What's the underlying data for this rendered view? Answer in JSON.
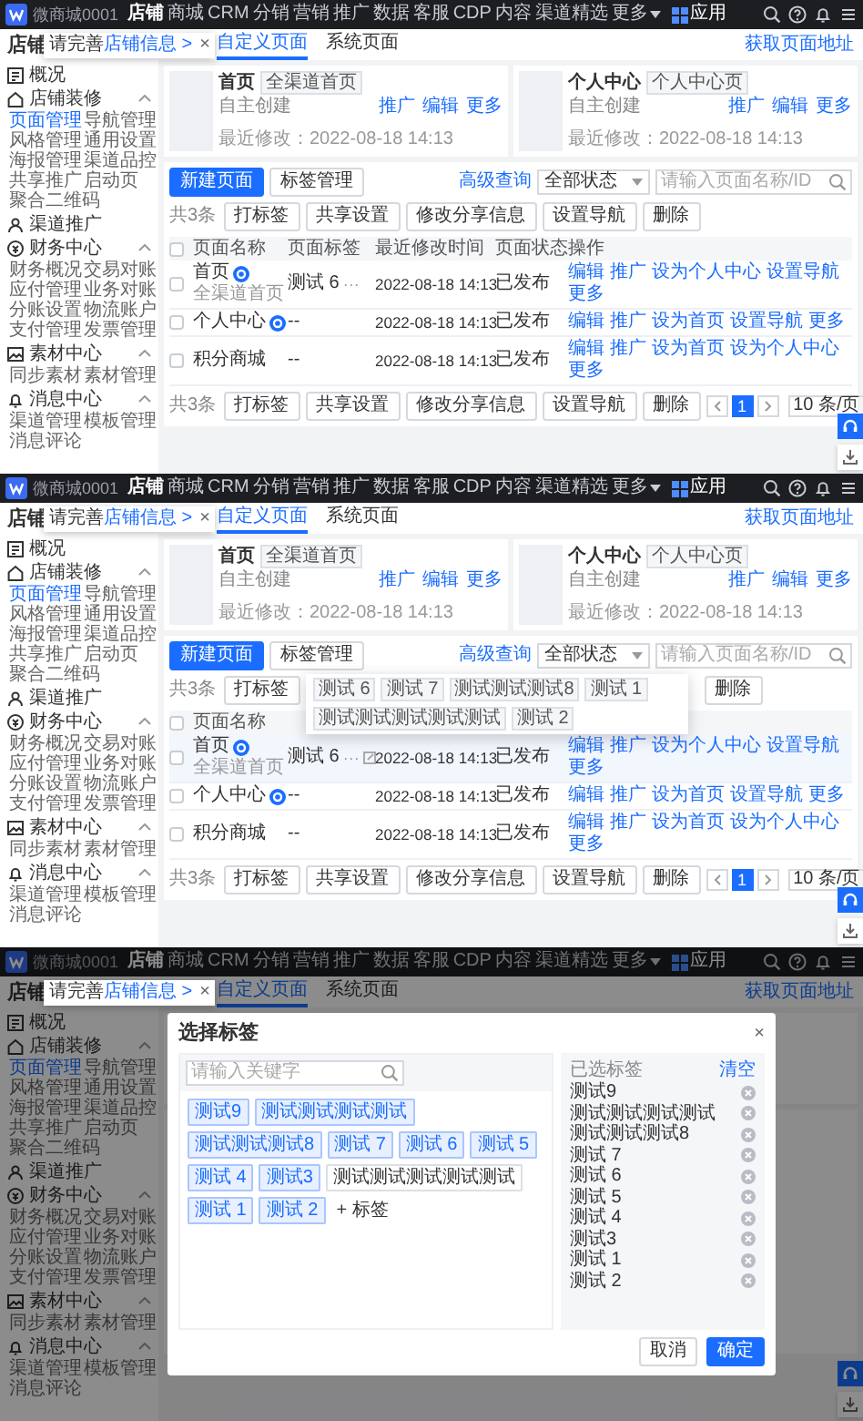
{
  "screens": [
    {
      "nav": {
        "brand": "微商城0001",
        "items": [
          {
            "label": "店铺",
            "kind": "link",
            "selected": true
          },
          {
            "label": "商城",
            "kind": "link",
            "selected": false
          },
          {
            "label": "CRM",
            "kind": "link",
            "selected": false
          },
          {
            "label": "分销",
            "kind": "link",
            "selected": false
          },
          {
            "label": "营销",
            "kind": "link",
            "selected": false
          },
          {
            "label": "推广",
            "kind": "link",
            "selected": false
          },
          {
            "label": "数据",
            "kind": "link",
            "selected": false
          },
          {
            "label": "客服",
            "kind": "link",
            "selected": false
          },
          {
            "label": "CDP",
            "kind": "link",
            "selected": false
          },
          {
            "label": "内容",
            "kind": "link",
            "selected": false
          },
          {
            "label": "渠道精选",
            "kind": "link",
            "selected": false
          },
          {
            "label": "更多",
            "kind": "dropdown",
            "selected": false
          },
          {
            "label": "应用",
            "kind": "apps",
            "selected": false
          }
        ]
      },
      "notice": {
        "text": "请完善",
        "link": "店铺信息 >",
        "close": "×"
      },
      "sidebar": {
        "title": "店铺",
        "groups": [
          {
            "label": "概况"
          },
          {
            "label": "店铺装修",
            "expanded": true,
            "items": [
              {
                "label": "页面管理",
                "selected": true
              },
              {
                "label": "导航管理",
                "selected": false
              },
              {
                "label": "风格管理",
                "selected": false
              },
              {
                "label": "通用设置",
                "selected": false
              },
              {
                "label": "海报管理",
                "selected": false
              },
              {
                "label": "渠道品控",
                "selected": false
              },
              {
                "label": "共享推广",
                "selected": false
              },
              {
                "label": "启动页",
                "selected": false
              },
              {
                "label": "聚合二维码",
                "selected": false
              }
            ]
          },
          {
            "label": "渠道推广"
          },
          {
            "label": "财务中心",
            "expanded": true,
            "items": [
              {
                "label": "财务概况",
                "selected": false
              },
              {
                "label": "交易对账",
                "selected": false
              },
              {
                "label": "应付管理",
                "selected": false
              },
              {
                "label": "业务对账",
                "selected": false
              },
              {
                "label": "分账设置",
                "selected": false
              },
              {
                "label": "物流账户",
                "selected": false
              },
              {
                "label": "支付管理",
                "selected": false
              },
              {
                "label": "发票管理",
                "selected": false
              }
            ]
          },
          {
            "label": "素材中心",
            "expanded": true,
            "items": [
              {
                "label": "同步素材",
                "selected": false
              },
              {
                "label": "素材管理",
                "selected": false
              }
            ]
          },
          {
            "label": "消息中心",
            "expanded": true,
            "items": [
              {
                "label": "渠道管理",
                "selected": false
              },
              {
                "label": "模板管理",
                "selected": false
              },
              {
                "label": "消息评论",
                "selected": false
              }
            ]
          }
        ]
      },
      "page": {
        "tabs": [
          {
            "label": "自定义页面",
            "selected": true
          },
          {
            "label": "系统页面",
            "selected": false
          }
        ],
        "link": "获取页面地址",
        "cards": [
          {
            "title": "首页",
            "tag": "全渠道首页",
            "source": "自主创建",
            "modified": "最近修改：2022-08-18 14:13",
            "actions": [
              "推广",
              "编辑",
              "更多"
            ]
          },
          {
            "title": "个人中心",
            "tag": "个人中心页",
            "source": "自主创建",
            "modified": "最近修改：2022-08-18 14:13",
            "actions": [
              "推广",
              "编辑",
              "更多"
            ]
          }
        ],
        "toolbar": {
          "primary": "新建页面",
          "secondary": "标签管理",
          "advanced": "高级查询",
          "status": "全部状态",
          "search_placeholder": "请输入页面名称/ID"
        },
        "batch": {
          "count": "共3条",
          "buttons": [
            "打标签",
            "共享设置",
            "修改分享信息",
            "设置导航",
            "删除"
          ]
        },
        "table": {
          "all_checked": false,
          "columns": [
            "页面名称",
            "页面标签",
            "最近修改时间",
            "页面状态",
            "操作"
          ],
          "rows": [
            {
              "name": "首页",
              "badge": true,
              "subtitle": "全渠道首页",
              "tag": "测试 6",
              "more": "···",
              "modified": "2022-08-18 14:13",
              "status": "已发布",
              "checked": false,
              "hovered": false,
              "actions": [
                "编辑",
                "推广",
                "设为个人中心",
                "设置导航",
                "更多"
              ]
            },
            {
              "name": "个人中心",
              "badge": true,
              "tag": "--",
              "modified": "2022-08-18 14:13",
              "status": "已发布",
              "checked": false,
              "hovered": false,
              "actions": [
                "编辑",
                "推广",
                "设为首页",
                "设置导航",
                "更多"
              ]
            },
            {
              "name": "积分商城",
              "badge": false,
              "tag": "--",
              "modified": "2022-08-18 14:13",
              "status": "已发布",
              "checked": false,
              "hovered": false,
              "actions": [
                "编辑",
                "推广",
                "设为首页",
                "设为个人中心",
                "更多"
              ]
            }
          ]
        },
        "footer": {
          "count": "共3条",
          "buttons": [
            "打标签",
            "共享设置",
            "修改分享信息",
            "设置导航",
            "删除"
          ],
          "pages": [
            {
              "label": "1",
              "selected": true
            }
          ],
          "page_size": "10 条/页"
        }
      }
    },
    {
      "nav": {
        "brand": "微商城0001",
        "items": [
          {
            "label": "店铺",
            "kind": "link",
            "selected": true
          },
          {
            "label": "商城",
            "kind": "link",
            "selected": false
          },
          {
            "label": "CRM",
            "kind": "link",
            "selected": false
          },
          {
            "label": "分销",
            "kind": "link",
            "selected": false
          },
          {
            "label": "营销",
            "kind": "link",
            "selected": false
          },
          {
            "label": "推广",
            "kind": "link",
            "selected": false
          },
          {
            "label": "数据",
            "kind": "link",
            "selected": false
          },
          {
            "label": "客服",
            "kind": "link",
            "selected": false
          },
          {
            "label": "CDP",
            "kind": "link",
            "selected": false
          },
          {
            "label": "内容",
            "kind": "link",
            "selected": false
          },
          {
            "label": "渠道精选",
            "kind": "link",
            "selected": false
          },
          {
            "label": "更多",
            "kind": "dropdown",
            "selected": false
          },
          {
            "label": "应用",
            "kind": "apps",
            "selected": false
          }
        ]
      },
      "notice": {
        "text": "请完善",
        "link": "店铺信息 >",
        "close": "×"
      },
      "sidebar": {
        "title": "店铺",
        "groups": [
          {
            "label": "概况"
          },
          {
            "label": "店铺装修",
            "expanded": true,
            "items": [
              {
                "label": "页面管理",
                "selected": true
              },
              {
                "label": "导航管理",
                "selected": false
              },
              {
                "label": "风格管理",
                "selected": false
              },
              {
                "label": "通用设置",
                "selected": false
              },
              {
                "label": "海报管理",
                "selected": false
              },
              {
                "label": "渠道品控",
                "selected": false
              },
              {
                "label": "共享推广",
                "selected": false
              },
              {
                "label": "启动页",
                "selected": false
              },
              {
                "label": "聚合二维码",
                "selected": false
              }
            ]
          },
          {
            "label": "渠道推广"
          },
          {
            "label": "财务中心",
            "expanded": true,
            "items": [
              {
                "label": "财务概况",
                "selected": false
              },
              {
                "label": "交易对账",
                "selected": false
              },
              {
                "label": "应付管理",
                "selected": false
              },
              {
                "label": "业务对账",
                "selected": false
              },
              {
                "label": "分账设置",
                "selected": false
              },
              {
                "label": "物流账户",
                "selected": false
              },
              {
                "label": "支付管理",
                "selected": false
              },
              {
                "label": "发票管理",
                "selected": false
              }
            ]
          },
          {
            "label": "素材中心",
            "expanded": true,
            "items": [
              {
                "label": "同步素材",
                "selected": false
              },
              {
                "label": "素材管理",
                "selected": false
              }
            ]
          },
          {
            "label": "消息中心",
            "expanded": true,
            "items": [
              {
                "label": "渠道管理",
                "selected": false
              },
              {
                "label": "模板管理",
                "selected": false
              },
              {
                "label": "消息评论",
                "selected": false
              }
            ]
          }
        ]
      },
      "page": {
        "tabs": [
          {
            "label": "自定义页面",
            "selected": true
          },
          {
            "label": "系统页面",
            "selected": false
          }
        ],
        "link": "获取页面地址",
        "cards": [
          {
            "title": "首页",
            "tag": "全渠道首页",
            "source": "自主创建",
            "modified": "最近修改：2022-08-18 14:13",
            "actions": [
              "推广",
              "编辑",
              "更多"
            ]
          },
          {
            "title": "个人中心",
            "tag": "个人中心页",
            "source": "自主创建",
            "modified": "最近修改：2022-08-18 14:13",
            "actions": [
              "推广",
              "编辑",
              "更多"
            ]
          }
        ],
        "toolbar": {
          "primary": "新建页面",
          "secondary": "标签管理",
          "advanced": "高级查询",
          "status": "全部状态",
          "search_placeholder": "请输入页面名称/ID"
        },
        "batch": {
          "count": "共3条",
          "buttons": [
            "打标签"
          ],
          "end_buttons": [
            "删除"
          ]
        },
        "table": {
          "all_checked": false,
          "columns": [
            "页面名称"
          ],
          "rows": [
            {
              "name": "首页",
              "badge": true,
              "subtitle": "全渠道首页",
              "tag": "测试 6",
              "more": "···",
              "modified": "2022-08-18 14:13",
              "status": "已发布",
              "checked": false,
              "hovered": true,
              "actions": [
                "编辑",
                "推广",
                "设为个人中心",
                "设置导航",
                "更多"
              ]
            },
            {
              "name": "个人中心",
              "badge": true,
              "tag": "--",
              "modified": "2022-08-18 14:13",
              "status": "已发布",
              "checked": false,
              "hovered": false,
              "actions": [
                "编辑",
                "推广",
                "设为首页",
                "设置导航",
                "更多"
              ]
            },
            {
              "name": "积分商城",
              "badge": false,
              "tag": "--",
              "modified": "2022-08-18 14:13",
              "status": "已发布",
              "checked": false,
              "hovered": false,
              "actions": [
                "编辑",
                "推广",
                "设为首页",
                "设为个人中心",
                "更多"
              ]
            }
          ]
        },
        "footer": {
          "count": "共3条",
          "buttons": [
            "打标签",
            "共享设置",
            "修改分享信息",
            "设置导航",
            "删除"
          ],
          "pages": [
            {
              "label": "1",
              "selected": true
            }
          ],
          "page_size": "10 条/页"
        }
      },
      "popover": {
        "tags": [
          "测试 6",
          "测试 7",
          "测试测试测试8",
          "测试 1",
          "测试测试测试测试测试",
          "测试 2"
        ]
      }
    },
    {
      "nav": {
        "brand": "微商城0001",
        "items": [
          {
            "label": "店铺",
            "kind": "link",
            "selected": true
          },
          {
            "label": "商城",
            "kind": "link",
            "selected": false
          },
          {
            "label": "CRM",
            "kind": "link",
            "selected": false
          },
          {
            "label": "分销",
            "kind": "link",
            "selected": false
          },
          {
            "label": "营销",
            "kind": "link",
            "selected": false
          },
          {
            "label": "推广",
            "kind": "link",
            "selected": false
          },
          {
            "label": "数据",
            "kind": "link",
            "selected": false
          },
          {
            "label": "客服",
            "kind": "link",
            "selected": false
          },
          {
            "label": "CDP",
            "kind": "link",
            "selected": false
          },
          {
            "label": "内容",
            "kind": "link",
            "selected": false
          },
          {
            "label": "渠道精选",
            "kind": "link",
            "selected": false
          },
          {
            "label": "更多",
            "kind": "dropdown",
            "selected": false
          },
          {
            "label": "应用",
            "kind": "apps",
            "selected": false
          }
        ]
      },
      "notice": {
        "text": "请完善",
        "link": "店铺信息 >",
        "close": "×"
      },
      "sidebar": {
        "title": "店铺",
        "groups": [
          {
            "label": "概况"
          },
          {
            "label": "店铺装修",
            "expanded": true,
            "items": [
              {
                "label": "页面管理",
                "selected": true
              },
              {
                "label": "导航管理",
                "selected": false
              },
              {
                "label": "风格管理",
                "selected": false
              },
              {
                "label": "通用设置",
                "selected": false
              },
              {
                "label": "海报管理",
                "selected": false
              },
              {
                "label": "渠道品控",
                "selected": false
              },
              {
                "label": "共享推广",
                "selected": false
              },
              {
                "label": "启动页",
                "selected": false
              },
              {
                "label": "聚合二维码",
                "selected": false
              }
            ]
          },
          {
            "label": "渠道推广"
          },
          {
            "label": "财务中心",
            "expanded": true,
            "items": [
              {
                "label": "财务概况",
                "selected": false
              },
              {
                "label": "交易对账",
                "selected": false
              },
              {
                "label": "应付管理",
                "selected": false
              },
              {
                "label": "业务对账",
                "selected": false
              },
              {
                "label": "分账设置",
                "selected": false
              },
              {
                "label": "物流账户",
                "selected": false
              },
              {
                "label": "支付管理",
                "selected": false
              },
              {
                "label": "发票管理",
                "selected": false
              }
            ]
          },
          {
            "label": "素材中心",
            "expanded": true,
            "items": [
              {
                "label": "同步素材",
                "selected": false
              },
              {
                "label": "素材管理",
                "selected": false
              }
            ]
          },
          {
            "label": "消息中心",
            "expanded": true,
            "items": [
              {
                "label": "渠道管理",
                "selected": false
              },
              {
                "label": "模板管理",
                "selected": false
              },
              {
                "label": "消息评论",
                "selected": false
              }
            ]
          }
        ]
      },
      "page": {
        "tabs": [
          {
            "label": "自定义页面",
            "selected": true
          },
          {
            "label": "系统页面",
            "selected": false
          }
        ],
        "link": "获取页面地址"
      },
      "modal": {
        "title": "选择标签",
        "close": "×",
        "search_placeholder": "请输入关键字",
        "tags": [
          {
            "label": "测试9",
            "selected": true
          },
          {
            "label": "测试测试测试测试",
            "selected": true
          },
          {
            "label": "测试测试测试8",
            "selected": true
          },
          {
            "label": "测试 7",
            "selected": true
          },
          {
            "label": "测试 6",
            "selected": true
          },
          {
            "label": "测试 5",
            "selected": true
          },
          {
            "label": "测试 4",
            "selected": true
          },
          {
            "label": "测试3",
            "selected": true
          },
          {
            "label": "测试测试测试测试测试",
            "selected": false
          },
          {
            "label": "测试 1",
            "selected": true
          },
          {
            "label": "测试 2",
            "selected": true
          }
        ],
        "add_label": "+ 标签",
        "selected_title": "已选标签",
        "clear": "清空",
        "selected_items": [
          "测试9",
          "测试测试测试测试",
          "测试测试测试8",
          "测试 7",
          "测试 6",
          "测试 5",
          "测试 4",
          "测试3",
          "测试 1",
          "测试 2"
        ],
        "cancel": "取消",
        "ok": "确定"
      }
    }
  ]
}
